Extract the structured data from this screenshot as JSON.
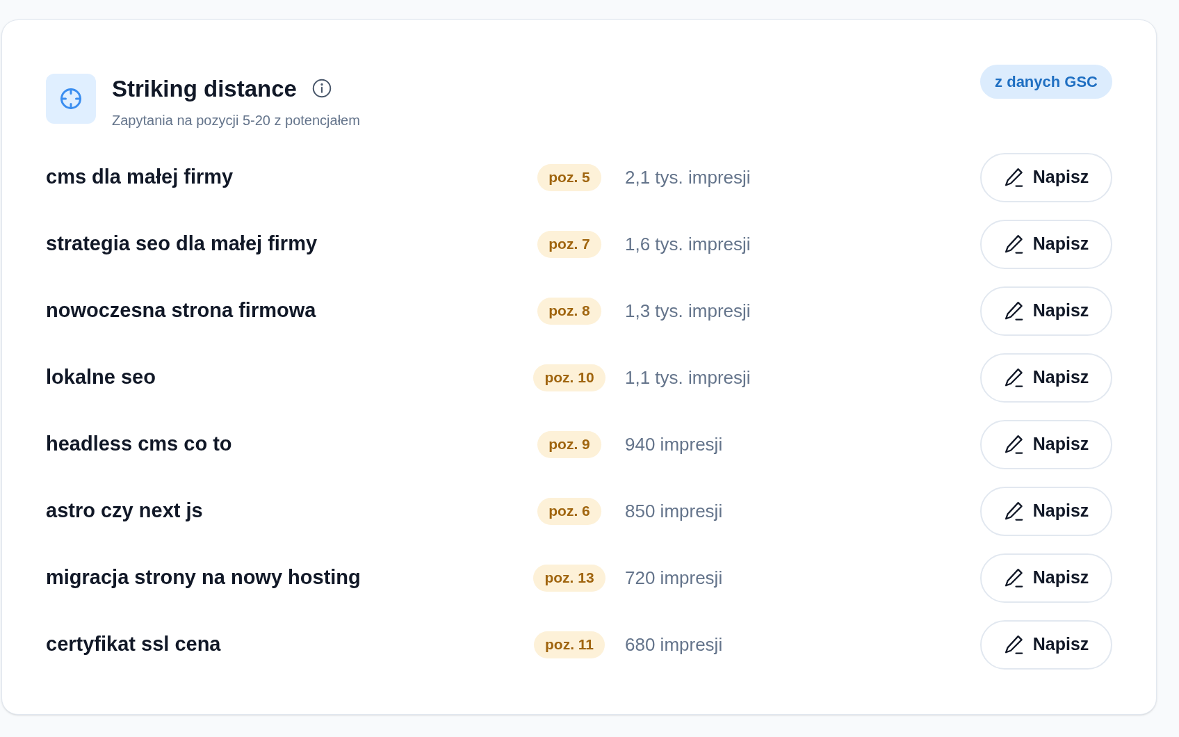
{
  "panel": {
    "title": "Striking distance",
    "subtitle": "Zapytania na pozycji 5-20 z potencjałem",
    "source_badge": "z danych GSC"
  },
  "queries": [
    {
      "query": "cms dla małej firmy",
      "position": "poz. 5",
      "impressions": "2,1 tys. impresji",
      "action": "Napisz"
    },
    {
      "query": "strategia seo dla małej firmy",
      "position": "poz. 7",
      "impressions": "1,6 tys. impresji",
      "action": "Napisz"
    },
    {
      "query": "nowoczesna strona firmowa",
      "position": "poz. 8",
      "impressions": "1,3 tys. impresji",
      "action": "Napisz"
    },
    {
      "query": "lokalne seo",
      "position": "poz. 10",
      "impressions": "1,1 tys. impresji",
      "action": "Napisz"
    },
    {
      "query": "headless cms co to",
      "position": "poz. 9",
      "impressions": "940 impresji",
      "action": "Napisz"
    },
    {
      "query": "astro czy next js",
      "position": "poz. 6",
      "impressions": "850 impresji",
      "action": "Napisz"
    },
    {
      "query": "migracja strony na nowy hosting",
      "position": "poz. 13",
      "impressions": "720 impresji",
      "action": "Napisz"
    },
    {
      "query": "certyfikat ssl cena",
      "position": "poz. 11",
      "impressions": "680 impresji",
      "action": "Napisz"
    }
  ]
}
